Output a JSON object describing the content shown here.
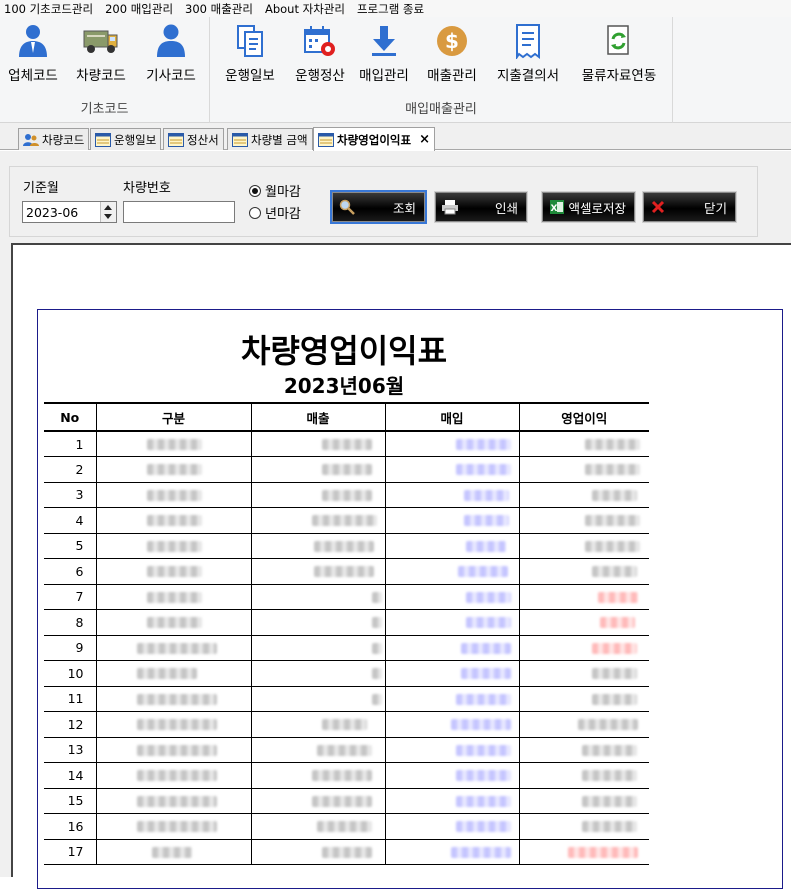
{
  "menu": {
    "items": [
      "100 기초코드관리",
      "200 매입관리",
      "300 매출관리",
      "About 자차관리",
      "프로그램 종료"
    ]
  },
  "ribbon": {
    "group1": {
      "title": "기초코드",
      "buttons": [
        {
          "label": "업체코드",
          "icon": "company-person-icon"
        },
        {
          "label": "차량코드",
          "icon": "truck-icon"
        },
        {
          "label": "기사코드",
          "icon": "driver-person-icon"
        }
      ]
    },
    "group2": {
      "title": "매입매출관리",
      "buttons": [
        {
          "label": "운행일보",
          "icon": "document-copy-icon"
        },
        {
          "label": "운행정산",
          "icon": "calendar-gear-icon"
        },
        {
          "label": "매입관리",
          "icon": "download-arrow-icon"
        },
        {
          "label": "매출관리",
          "icon": "dollar-coin-icon"
        },
        {
          "label": "지출결의서",
          "icon": "receipt-icon"
        },
        {
          "label": "물류자료연동",
          "icon": "sync-document-icon"
        }
      ]
    }
  },
  "tabs": [
    {
      "label": "차량코드",
      "active": false
    },
    {
      "label": "운행일보",
      "active": false
    },
    {
      "label": "정산서",
      "active": false
    },
    {
      "label": "차량별 금액",
      "active": false
    },
    {
      "label": "차량영업이익표",
      "active": true,
      "close": "×"
    }
  ],
  "filters": {
    "month_label": "기준월",
    "month_value": "2023-06",
    "vehicle_label": "차량번호",
    "vehicle_value": "",
    "radio_monthly": "월마감",
    "radio_yearly": "년마감",
    "selected": "월마감"
  },
  "actions": {
    "search": "조회",
    "print": "인쇄",
    "excel": "액셀로저장",
    "close": "닫기"
  },
  "report": {
    "title": "차량영업이익표",
    "subtitle": "2023년06월",
    "columns": [
      "No",
      "구분",
      "매출",
      "매입",
      "영업이익"
    ],
    "rows": [
      "1",
      "2",
      "3",
      "4",
      "5",
      "6",
      "7",
      "8",
      "9",
      "10",
      "11",
      "12",
      "13",
      "14",
      "15",
      "16",
      "17"
    ]
  },
  "colors": {
    "ribbon_icon_blue": "#2f6fd0",
    "purchase_blur": "#9696ff",
    "profit_negative": "#ff8282",
    "report_border": "#1b1b8a"
  }
}
